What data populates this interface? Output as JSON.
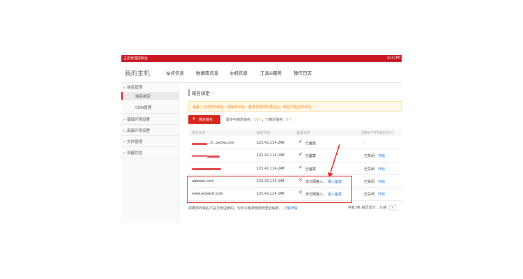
{
  "window": {
    "title": "主机管理控制台",
    "user": "qxx160"
  },
  "nav": {
    "brand": "我的主机",
    "items": [
      "站点信息",
      "数据库信息",
      "主机信息",
      "工具&服务",
      "操作日志"
    ]
  },
  "sidebar": {
    "items": [
      {
        "label": "域名管理",
        "arrow": "∨"
      },
      {
        "label": "域名绑定",
        "arrow": ""
      },
      {
        "label": "CDN管理",
        "arrow": ""
      },
      {
        "label": "基础环境设置",
        "arrow": ">"
      },
      {
        "label": "高级环境设置",
        "arrow": ">"
      },
      {
        "label": "文件管理",
        "arrow": ">"
      },
      {
        "label": "流量状态",
        "arrow": ">"
      }
    ]
  },
  "page": {
    "title": "域名绑定",
    "info_icon": "ⓘ",
    "tip": "温馨：已绑定的域名，需解析状态、备案状态同时通过后，网站才能正常访问。",
    "bind_button": "绑定域名",
    "limit": {
      "label1": "最多可绑定域名：",
      "max": "20个",
      "label2": "，已绑定域名：",
      "count": "5个"
    }
  },
  "table": {
    "headers": [
      "绑定域名",
      "解析地址",
      "备案状态",
      "强制HTTPS跳转访问"
    ],
    "rows": [
      {
        "domain": "...5...xw3w.com",
        "ip": "121.42.114.248",
        "icon": "✔",
        "status": "已备案",
        "https": "-",
        "action": "",
        "redacted": true
      },
      {
        "domain": "",
        "ip": "121.42.114.248",
        "icon": "✔",
        "status": "已备案",
        "https": "已关闭",
        "action": "开启",
        "redacted": true
      },
      {
        "domain": "",
        "ip": "121.42.114.248",
        "icon": "✔",
        "status": "已备案",
        "https": "已关闭",
        "action": "开启",
        "redacted": true
      },
      {
        "domain": "apbwdc.com",
        "ip": "121.42.114.248",
        "icon": "✕",
        "status": "未万网接入，",
        "link": "接入备案",
        "https": "已关闭",
        "action": "开启",
        "redacted": false
      },
      {
        "domain": "www.apbwdc.com",
        "ip": "121.42.114.248",
        "icon": "✕",
        "status": "未万网接入，",
        "link": "接入备案",
        "https": "已关闭",
        "action": "开启",
        "redacted": false
      }
    ]
  },
  "footer": {
    "text": "如果您的域名不是万网注册的，也可以免费使用阿里云解析。",
    "link": "了解详情",
    "pager": "共有5条,每页显示：",
    "page_size": "10条",
    "page_box": "«"
  },
  "colors": {
    "brand": "#c81623",
    "highlight_box": "#e02020",
    "ok": "#2aa52a",
    "bad": "#e0312a",
    "link": "#1f6fd6"
  }
}
